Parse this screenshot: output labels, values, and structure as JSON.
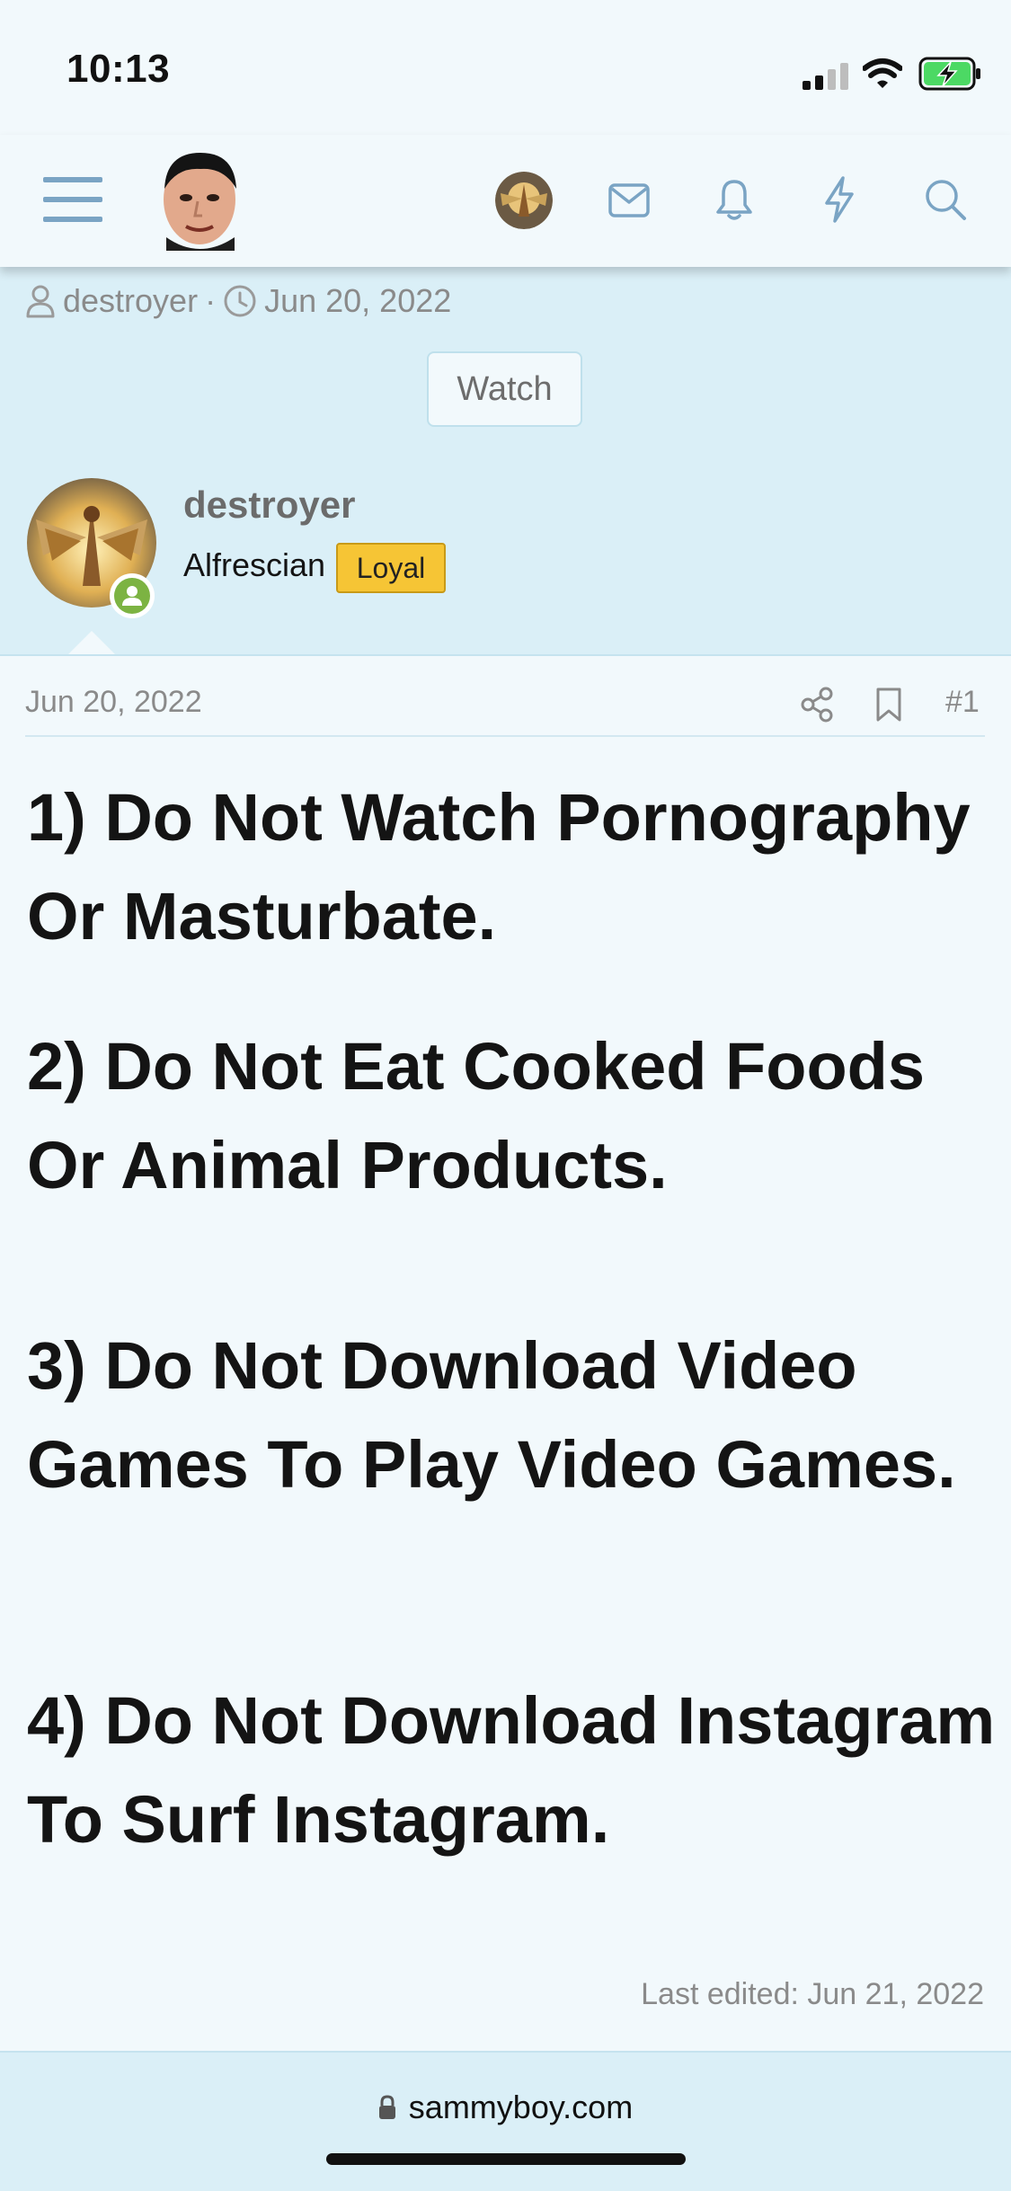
{
  "status_bar": {
    "time": "10:13"
  },
  "header": {
    "menu_icon": "hamburger-menu-icon",
    "logo": "site-logo-face",
    "icons": [
      "user-avatar",
      "envelope-icon",
      "bell-icon",
      "bolt-icon",
      "search-icon"
    ]
  },
  "thread": {
    "author": "destroyer",
    "separator": "·",
    "date": "Jun 20, 2022",
    "watch_label": "Watch"
  },
  "post": {
    "username": "destroyer",
    "user_title": "Alfrescian",
    "badge": "Loyal",
    "date": "Jun 20, 2022",
    "number": "#1",
    "rules": [
      "1) Do Not Watch Pornography Or Masturbate.",
      "2) Do Not Eat Cooked Foods Or Animal Products.",
      "3) Do Not Download Video Games To Play Video Games.",
      "4) Do Not Download Instagram To Surf Instagram."
    ],
    "last_edited": "Last edited: Jun 21, 2022"
  },
  "browser": {
    "url": "sammyboy.com"
  },
  "colors": {
    "page_bg": "#f2f9fc",
    "band_bg": "#daeff7",
    "accent": "#6d97b7",
    "badge_yellow": "#f6c535",
    "online_green": "#7cb342"
  }
}
